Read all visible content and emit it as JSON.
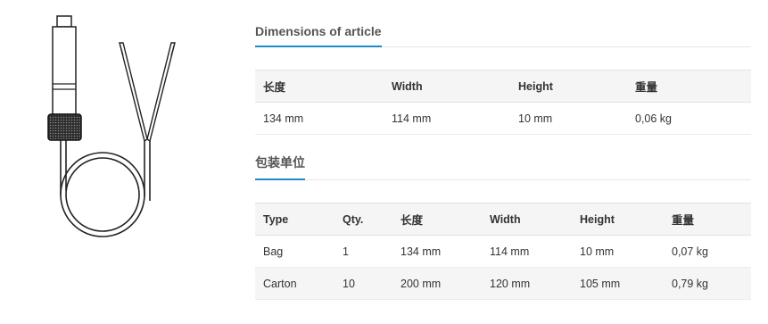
{
  "dimensions": {
    "title": "Dimensions of article",
    "headers": [
      "长度",
      "Width",
      "Height",
      "重量"
    ],
    "rows": [
      [
        "134 mm",
        "114 mm",
        "10 mm",
        "0,06 kg"
      ]
    ]
  },
  "packaging": {
    "title": "包装单位",
    "headers": [
      "Type",
      "Qty.",
      "长度",
      "Width",
      "Height",
      "重量"
    ],
    "rows": [
      [
        "Bag",
        "1",
        "134 mm",
        "114 mm",
        "10 mm",
        "0,07 kg"
      ],
      [
        "Carton",
        "10",
        "200 mm",
        "120 mm",
        "105 mm",
        "0,79 kg"
      ]
    ]
  },
  "colors": {
    "accent": "#1e88c8",
    "row_alt": "#f5f5f5"
  },
  "image": {
    "icon": "sensor-cable-product-drawing"
  }
}
